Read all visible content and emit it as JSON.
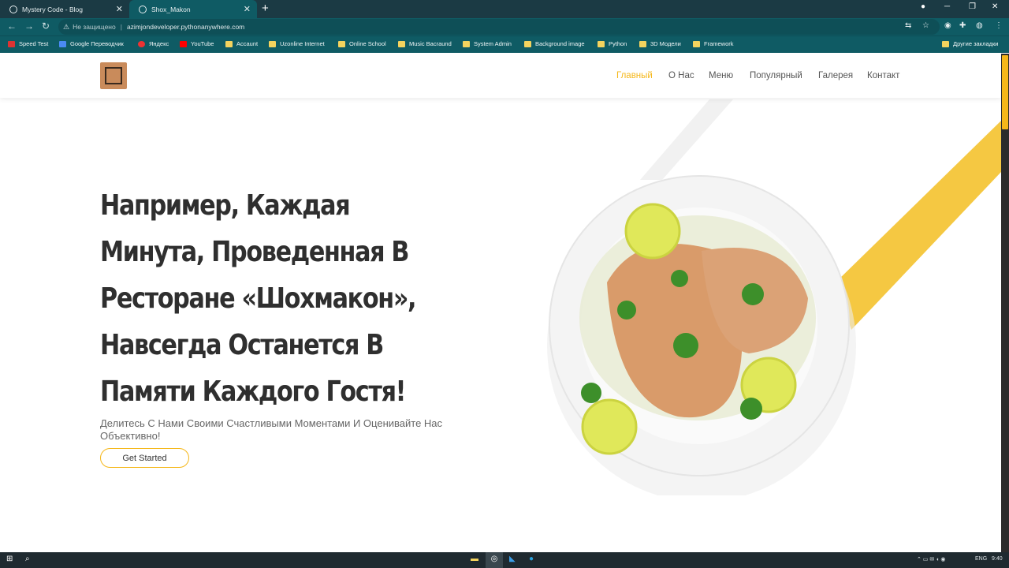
{
  "browser": {
    "tabs": [
      {
        "title": "Mystery Code - Blog",
        "active": false
      },
      {
        "title": "Shox_Makon",
        "active": true
      }
    ],
    "address": {
      "security_text": "Не защищено",
      "url": "azimjondeveloper.pythonanywhere.com"
    },
    "bookmarks": [
      {
        "label": "Speed Test",
        "icon": "speedtest-icon"
      },
      {
        "label": "Google Переводчик",
        "icon": "translate-icon"
      },
      {
        "label": "Яндекс",
        "icon": "yandex-icon"
      },
      {
        "label": "YouTube",
        "icon": "youtube-icon"
      },
      {
        "label": "Accaunt",
        "icon": "folder-icon"
      },
      {
        "label": "Uzonline Internet",
        "icon": "folder-icon"
      },
      {
        "label": "Online School",
        "icon": "folder-icon"
      },
      {
        "label": "Music Bacraund",
        "icon": "folder-icon"
      },
      {
        "label": "System Admin",
        "icon": "folder-icon"
      },
      {
        "label": "Background image",
        "icon": "folder-icon"
      },
      {
        "label": "Python",
        "icon": "folder-icon"
      },
      {
        "label": "3D Модели",
        "icon": "folder-icon"
      },
      {
        "label": "Framework",
        "icon": "folder-icon"
      }
    ],
    "other_bookmarks": "Другие закладки"
  },
  "site": {
    "nav": [
      "Главный",
      "О Нас",
      "Меню",
      "Популярный",
      "Галерея",
      "Контакт"
    ],
    "active_nav": "Главный",
    "hero": {
      "title": "Например, Каждая Минута, Проведенная В Ресторане «Шохмакон», Навсегда Останется В Памяти Каждого Гостя!",
      "subtitle": "Делитесь С Нами Своими Счастливыми Моментами И Оценивайте Нас Объективно!",
      "cta": "Get Started"
    },
    "colors": {
      "accent": "#f5b719",
      "heading": "#2f2f2f"
    }
  },
  "taskbar": {
    "language": "ENG",
    "time": "9:40"
  }
}
